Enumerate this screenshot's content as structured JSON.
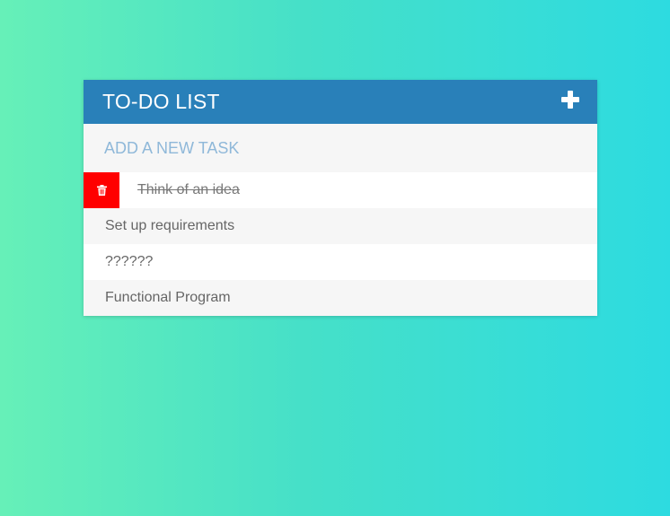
{
  "header": {
    "title": "TO-DO LIST",
    "add_icon": "plus-icon"
  },
  "new_task": {
    "placeholder": "ADD A NEW TASK",
    "value": ""
  },
  "tasks": [
    {
      "text": "Think of an idea",
      "completed": true,
      "hovered": true,
      "delete_icon": "trash-icon"
    },
    {
      "text": "Set up requirements",
      "completed": false
    },
    {
      "text": "??????",
      "completed": false
    },
    {
      "text": "Functional Program",
      "completed": false
    }
  ],
  "colors": {
    "header_bg": "#2980b9",
    "delete_bg": "#ff0000",
    "placeholder": "#8fb8d9"
  }
}
